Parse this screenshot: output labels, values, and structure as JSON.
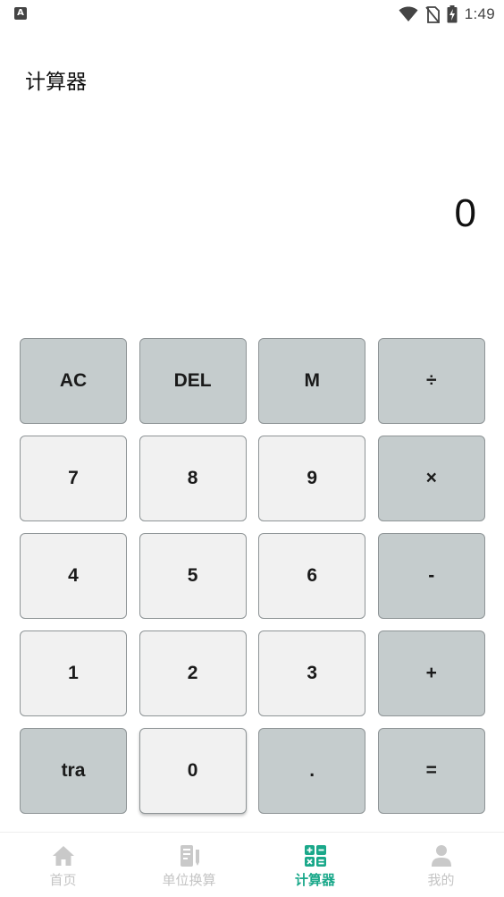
{
  "status_bar": {
    "time": "1:49",
    "left_icon_letter": "A",
    "icons": [
      "app-notification-icon",
      "wifi-icon",
      "no-sim-icon",
      "battery-charging-icon"
    ]
  },
  "page_title": "计算器",
  "display_value": "0",
  "keypad": {
    "ac": "AC",
    "del": "DEL",
    "m": "M",
    "divide": "÷",
    "seven": "7",
    "eight": "8",
    "nine": "9",
    "multiply": "×",
    "four": "4",
    "five": "5",
    "six": "6",
    "minus": "-",
    "one": "1",
    "two": "2",
    "three": "3",
    "plus": "+",
    "tra": "tra",
    "zero": "0",
    "dot": ".",
    "equals": "="
  },
  "bottom_nav": {
    "items": [
      {
        "label": "首页",
        "icon": "home-icon",
        "active": false
      },
      {
        "label": "单位换算",
        "icon": "unit-convert-icon",
        "active": false
      },
      {
        "label": "计算器",
        "icon": "calculator-icon",
        "active": true
      },
      {
        "label": "我的",
        "icon": "user-icon",
        "active": false
      }
    ]
  },
  "colors": {
    "accent": "#1aa88a",
    "func_key": "#c5cccd",
    "num_key": "#f1f1f1",
    "inactive_nav": "#c4c4c4"
  }
}
